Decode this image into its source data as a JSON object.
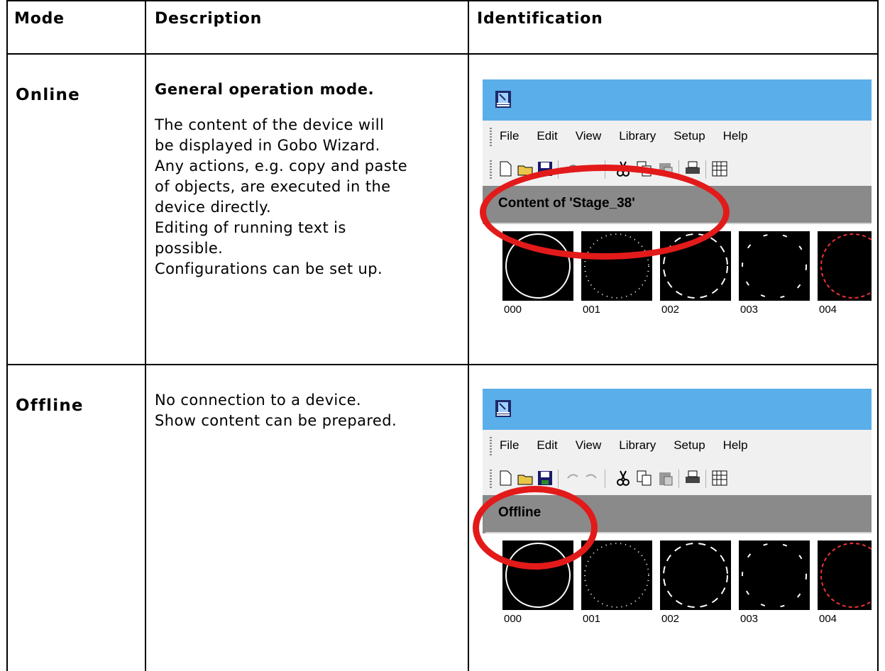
{
  "table": {
    "headers": [
      "Mode",
      "Description",
      "Identification"
    ],
    "rows": [
      {
        "mode": "Online",
        "desc_bold": "General operation mode.",
        "desc_body": "The content of the device will\nbe displayed in Gobo Wizard.\nAny actions, e.g. copy and paste\nof objects, are executed in the\ndevice directly.\nEditing of running text is\npossible.\nConfigurations can be set up.",
        "screenshot": {
          "menu": [
            "File",
            "Edit",
            "View",
            "Library",
            "Setup",
            "Help"
          ],
          "content_label": "Content of 'Stage_38'",
          "thumbnails": [
            "000",
            "001",
            "002",
            "003",
            "004"
          ]
        }
      },
      {
        "mode": "Offline",
        "desc_bold": "",
        "desc_body": "No connection to a device.\nShow content can be prepared.",
        "screenshot": {
          "menu": [
            "File",
            "Edit",
            "View",
            "Library",
            "Setup",
            "Help"
          ],
          "content_label": "Offline",
          "thumbnails": [
            "000",
            "001",
            "002",
            "003",
            "004"
          ]
        }
      }
    ]
  },
  "colors": {
    "titlebar": "#5aaeea",
    "highlight_ring": "#e31a1a",
    "content_bar": "#8a8a8a"
  },
  "icons": [
    "app-wizard-icon",
    "new-icon",
    "open-icon",
    "save-icon",
    "undo-icon",
    "redo-icon",
    "cut-icon",
    "copy-icon",
    "paste-icon",
    "print-icon",
    "grid-icon"
  ]
}
